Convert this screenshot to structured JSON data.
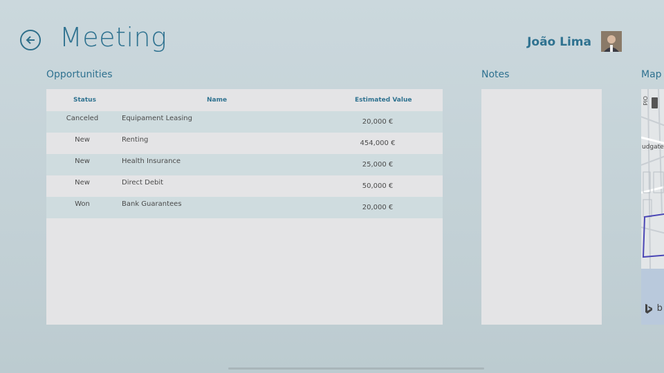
{
  "header": {
    "title": "Meeting",
    "user_name": "João Lima"
  },
  "sections": {
    "opportunities": "Opportunities",
    "notes": "Notes",
    "map": "Map"
  },
  "table": {
    "columns": [
      "Status",
      "Name",
      "Estimated Value"
    ],
    "rows": [
      {
        "status": "Canceled",
        "name": "Equipament Leasing",
        "value": "20,000 €"
      },
      {
        "status": "New",
        "name": "Renting",
        "value": "454,000 €"
      },
      {
        "status": "New",
        "name": "Health Insurance",
        "value": "25,000 €"
      },
      {
        "status": "New",
        "name": "Direct Debit",
        "value": "50,000 €"
      },
      {
        "status": "Won",
        "name": "Bank Guarantees",
        "value": "20,000 €"
      }
    ]
  },
  "map": {
    "street_labels": [
      "Old Bailey",
      "udgate"
    ],
    "logo_text": "b"
  },
  "colors": {
    "accent": "#2f7290",
    "row_alt": "#cfdcdf",
    "panel": "#e4e4e6"
  }
}
